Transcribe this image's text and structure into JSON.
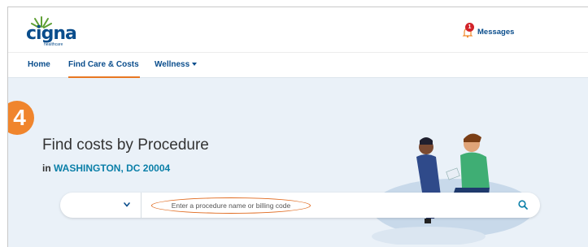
{
  "brand": {
    "wordmark": "cigna",
    "subtext": "healthcare",
    "color": "#0a4d8c"
  },
  "header": {
    "messages_label": "Messages",
    "messages_count": "1",
    "bell_icon": "bell-icon"
  },
  "nav": {
    "items": [
      {
        "label": "Home"
      },
      {
        "label": "Find Care & Costs",
        "active": true
      },
      {
        "label": "Wellness"
      }
    ]
  },
  "hero": {
    "step_number": "4",
    "title": "Find costs by Procedure",
    "location_prefix": "in",
    "location": "WASHINGTON, DC 20004"
  },
  "search": {
    "placeholder": "Enter a procedure name or billing code",
    "select_value": "",
    "search_icon": "search-icon"
  },
  "colors": {
    "accent": "#e87722",
    "primary": "#0a4d8c",
    "hero_bg": "#eaf1f8",
    "link": "#0a7fa8",
    "badge": "#d2232a"
  }
}
